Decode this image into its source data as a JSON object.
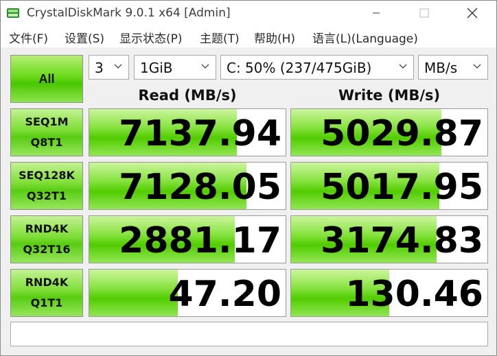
{
  "window": {
    "title": "CrystalDiskMark 9.0.1 x64 [Admin]"
  },
  "menu": [
    {
      "label": "文件(F)"
    },
    {
      "label": "设置(S)"
    },
    {
      "label": "显示状态(P)"
    },
    {
      "label": "主题(T)"
    },
    {
      "label": "帮助(H)"
    },
    {
      "label": "语言(L)(Language)"
    }
  ],
  "toolbar": {
    "all_label": "All",
    "count": "3",
    "size": "1GiB",
    "drive": "C: 50% (237/475GiB)",
    "unit": "MB/s"
  },
  "columns": {
    "read": "Read (MB/s)",
    "write": "Write (MB/s)"
  },
  "rows": [
    {
      "line1": "SEQ1M",
      "line2": "Q8T1",
      "read": "7137.94",
      "write": "5029.87",
      "read_fill": 0.75,
      "write_fill": 0.765
    },
    {
      "line1": "SEQ128K",
      "line2": "Q32T1",
      "read": "7128.05",
      "write": "5017.95",
      "read_fill": 0.8,
      "write_fill": 0.755
    },
    {
      "line1": "RND4K",
      "line2": "Q32T16",
      "read": "2881.17",
      "write": "3174.83",
      "read_fill": 0.74,
      "write_fill": 0.74
    },
    {
      "line1": "RND4K",
      "line2": "Q1T1",
      "read": "47.20",
      "write": "130.46",
      "read_fill": 0.45,
      "write_fill": 0.5
    }
  ],
  "status_text": "",
  "colors": {
    "bar_green": "#51cc00",
    "title_text": "#3c3c3c"
  }
}
